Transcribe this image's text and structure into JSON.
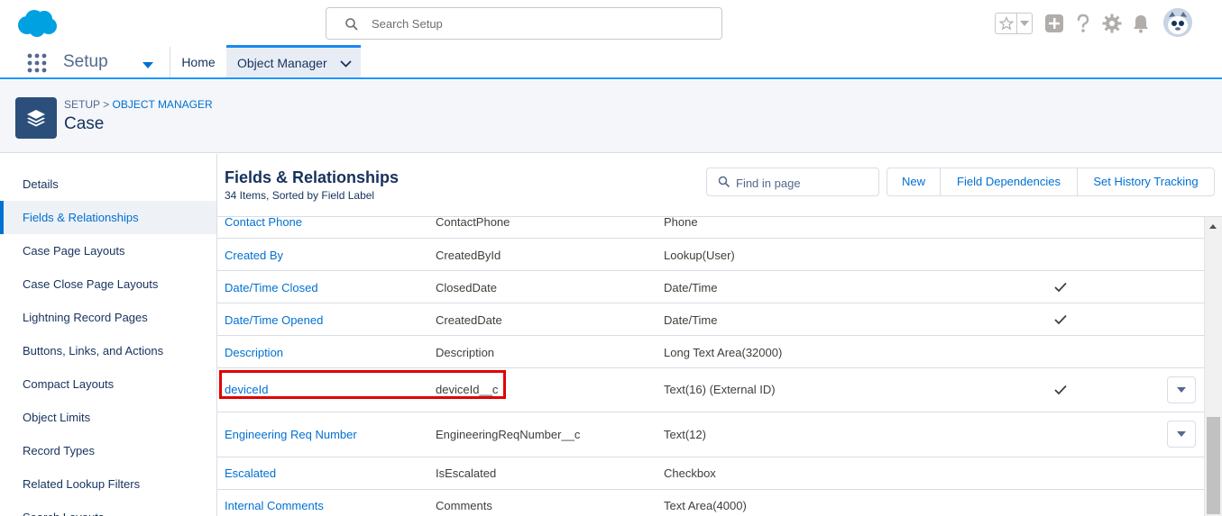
{
  "global": {
    "search_placeholder": "Search Setup"
  },
  "nav": {
    "app_name": "Setup",
    "home": "Home",
    "object_manager": "Object Manager"
  },
  "page": {
    "breadcrumb_setup": "SETUP",
    "breadcrumb_sep": " > ",
    "breadcrumb_om": "OBJECT MANAGER",
    "title": "Case"
  },
  "sidebar": {
    "items": [
      {
        "label": "Details"
      },
      {
        "label": "Fields & Relationships"
      },
      {
        "label": "Case Page Layouts"
      },
      {
        "label": "Case Close Page Layouts"
      },
      {
        "label": "Lightning Record Pages"
      },
      {
        "label": "Buttons, Links, and Actions"
      },
      {
        "label": "Compact Layouts"
      },
      {
        "label": "Object Limits"
      },
      {
        "label": "Record Types"
      },
      {
        "label": "Related Lookup Filters"
      },
      {
        "label": "Search Layouts"
      }
    ]
  },
  "main": {
    "title": "Fields & Relationships",
    "subtitle": "34 Items, Sorted by Field Label",
    "find_placeholder": "Find in page",
    "buttons": {
      "new": "New",
      "field_dependencies": "Field Dependencies",
      "set_history_tracking": "Set History Tracking"
    },
    "rows": [
      {
        "label": "Contact Phone",
        "api": "ContactPhone",
        "type": "Phone"
      },
      {
        "label": "Created By",
        "api": "CreatedById",
        "type": "Lookup(User)"
      },
      {
        "label": "Date/Time Closed",
        "api": "ClosedDate",
        "type": "Date/Time"
      },
      {
        "label": "Date/Time Opened",
        "api": "CreatedDate",
        "type": "Date/Time"
      },
      {
        "label": "Description",
        "api": "Description",
        "type": "Long Text Area(32000)"
      },
      {
        "label": "deviceId",
        "api": "deviceId__c",
        "type": "Text(16) (External ID)"
      },
      {
        "label": "Engineering Req Number",
        "api": "EngineeringReqNumber__c",
        "type": "Text(12)"
      },
      {
        "label": "Escalated",
        "api": "IsEscalated",
        "type": "Checkbox"
      },
      {
        "label": "Internal Comments",
        "api": "Comments",
        "type": "Text Area(4000)"
      }
    ]
  },
  "colors": {
    "brand": "#0070d2",
    "highlight": "#e00000",
    "object_icon": "#2b4f7a"
  }
}
